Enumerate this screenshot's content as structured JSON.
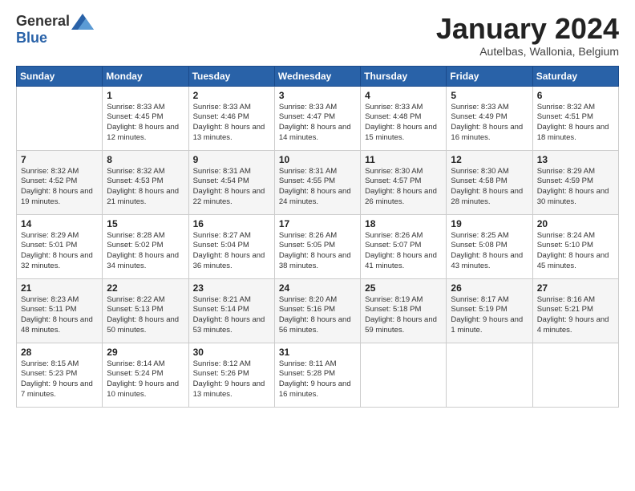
{
  "header": {
    "logo_general": "General",
    "logo_blue": "Blue",
    "month_title": "January 2024",
    "subtitle": "Autelbas, Wallonia, Belgium"
  },
  "days_of_week": [
    "Sunday",
    "Monday",
    "Tuesday",
    "Wednesday",
    "Thursday",
    "Friday",
    "Saturday"
  ],
  "weeks": [
    [
      {
        "day": "",
        "sunrise": "",
        "sunset": "",
        "daylight": ""
      },
      {
        "day": "1",
        "sunrise": "Sunrise: 8:33 AM",
        "sunset": "Sunset: 4:45 PM",
        "daylight": "Daylight: 8 hours and 12 minutes."
      },
      {
        "day": "2",
        "sunrise": "Sunrise: 8:33 AM",
        "sunset": "Sunset: 4:46 PM",
        "daylight": "Daylight: 8 hours and 13 minutes."
      },
      {
        "day": "3",
        "sunrise": "Sunrise: 8:33 AM",
        "sunset": "Sunset: 4:47 PM",
        "daylight": "Daylight: 8 hours and 14 minutes."
      },
      {
        "day": "4",
        "sunrise": "Sunrise: 8:33 AM",
        "sunset": "Sunset: 4:48 PM",
        "daylight": "Daylight: 8 hours and 15 minutes."
      },
      {
        "day": "5",
        "sunrise": "Sunrise: 8:33 AM",
        "sunset": "Sunset: 4:49 PM",
        "daylight": "Daylight: 8 hours and 16 minutes."
      },
      {
        "day": "6",
        "sunrise": "Sunrise: 8:32 AM",
        "sunset": "Sunset: 4:51 PM",
        "daylight": "Daylight: 8 hours and 18 minutes."
      }
    ],
    [
      {
        "day": "7",
        "sunrise": "Sunrise: 8:32 AM",
        "sunset": "Sunset: 4:52 PM",
        "daylight": "Daylight: 8 hours and 19 minutes."
      },
      {
        "day": "8",
        "sunrise": "Sunrise: 8:32 AM",
        "sunset": "Sunset: 4:53 PM",
        "daylight": "Daylight: 8 hours and 21 minutes."
      },
      {
        "day": "9",
        "sunrise": "Sunrise: 8:31 AM",
        "sunset": "Sunset: 4:54 PM",
        "daylight": "Daylight: 8 hours and 22 minutes."
      },
      {
        "day": "10",
        "sunrise": "Sunrise: 8:31 AM",
        "sunset": "Sunset: 4:55 PM",
        "daylight": "Daylight: 8 hours and 24 minutes."
      },
      {
        "day": "11",
        "sunrise": "Sunrise: 8:30 AM",
        "sunset": "Sunset: 4:57 PM",
        "daylight": "Daylight: 8 hours and 26 minutes."
      },
      {
        "day": "12",
        "sunrise": "Sunrise: 8:30 AM",
        "sunset": "Sunset: 4:58 PM",
        "daylight": "Daylight: 8 hours and 28 minutes."
      },
      {
        "day": "13",
        "sunrise": "Sunrise: 8:29 AM",
        "sunset": "Sunset: 4:59 PM",
        "daylight": "Daylight: 8 hours and 30 minutes."
      }
    ],
    [
      {
        "day": "14",
        "sunrise": "Sunrise: 8:29 AM",
        "sunset": "Sunset: 5:01 PM",
        "daylight": "Daylight: 8 hours and 32 minutes."
      },
      {
        "day": "15",
        "sunrise": "Sunrise: 8:28 AM",
        "sunset": "Sunset: 5:02 PM",
        "daylight": "Daylight: 8 hours and 34 minutes."
      },
      {
        "day": "16",
        "sunrise": "Sunrise: 8:27 AM",
        "sunset": "Sunset: 5:04 PM",
        "daylight": "Daylight: 8 hours and 36 minutes."
      },
      {
        "day": "17",
        "sunrise": "Sunrise: 8:26 AM",
        "sunset": "Sunset: 5:05 PM",
        "daylight": "Daylight: 8 hours and 38 minutes."
      },
      {
        "day": "18",
        "sunrise": "Sunrise: 8:26 AM",
        "sunset": "Sunset: 5:07 PM",
        "daylight": "Daylight: 8 hours and 41 minutes."
      },
      {
        "day": "19",
        "sunrise": "Sunrise: 8:25 AM",
        "sunset": "Sunset: 5:08 PM",
        "daylight": "Daylight: 8 hours and 43 minutes."
      },
      {
        "day": "20",
        "sunrise": "Sunrise: 8:24 AM",
        "sunset": "Sunset: 5:10 PM",
        "daylight": "Daylight: 8 hours and 45 minutes."
      }
    ],
    [
      {
        "day": "21",
        "sunrise": "Sunrise: 8:23 AM",
        "sunset": "Sunset: 5:11 PM",
        "daylight": "Daylight: 8 hours and 48 minutes."
      },
      {
        "day": "22",
        "sunrise": "Sunrise: 8:22 AM",
        "sunset": "Sunset: 5:13 PM",
        "daylight": "Daylight: 8 hours and 50 minutes."
      },
      {
        "day": "23",
        "sunrise": "Sunrise: 8:21 AM",
        "sunset": "Sunset: 5:14 PM",
        "daylight": "Daylight: 8 hours and 53 minutes."
      },
      {
        "day": "24",
        "sunrise": "Sunrise: 8:20 AM",
        "sunset": "Sunset: 5:16 PM",
        "daylight": "Daylight: 8 hours and 56 minutes."
      },
      {
        "day": "25",
        "sunrise": "Sunrise: 8:19 AM",
        "sunset": "Sunset: 5:18 PM",
        "daylight": "Daylight: 8 hours and 59 minutes."
      },
      {
        "day": "26",
        "sunrise": "Sunrise: 8:17 AM",
        "sunset": "Sunset: 5:19 PM",
        "daylight": "Daylight: 9 hours and 1 minute."
      },
      {
        "day": "27",
        "sunrise": "Sunrise: 8:16 AM",
        "sunset": "Sunset: 5:21 PM",
        "daylight": "Daylight: 9 hours and 4 minutes."
      }
    ],
    [
      {
        "day": "28",
        "sunrise": "Sunrise: 8:15 AM",
        "sunset": "Sunset: 5:23 PM",
        "daylight": "Daylight: 9 hours and 7 minutes."
      },
      {
        "day": "29",
        "sunrise": "Sunrise: 8:14 AM",
        "sunset": "Sunset: 5:24 PM",
        "daylight": "Daylight: 9 hours and 10 minutes."
      },
      {
        "day": "30",
        "sunrise": "Sunrise: 8:12 AM",
        "sunset": "Sunset: 5:26 PM",
        "daylight": "Daylight: 9 hours and 13 minutes."
      },
      {
        "day": "31",
        "sunrise": "Sunrise: 8:11 AM",
        "sunset": "Sunset: 5:28 PM",
        "daylight": "Daylight: 9 hours and 16 minutes."
      },
      {
        "day": "",
        "sunrise": "",
        "sunset": "",
        "daylight": ""
      },
      {
        "day": "",
        "sunrise": "",
        "sunset": "",
        "daylight": ""
      },
      {
        "day": "",
        "sunrise": "",
        "sunset": "",
        "daylight": ""
      }
    ]
  ]
}
